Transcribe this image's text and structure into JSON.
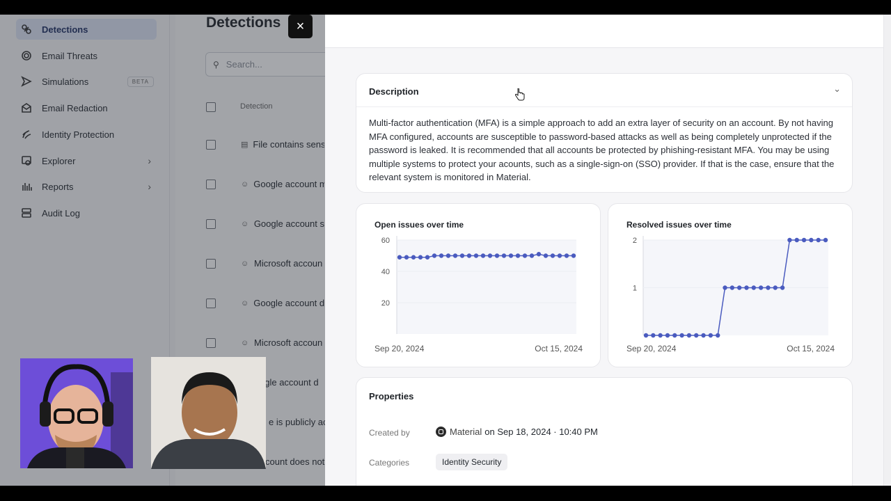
{
  "sidebar": {
    "items": [
      {
        "label": "Detections",
        "icon": "detections-icon",
        "active": true
      },
      {
        "label": "Email Threats",
        "icon": "email-threats-icon"
      },
      {
        "label": "Simulations",
        "icon": "simulations-icon",
        "badge": "BETA"
      },
      {
        "label": "Email Redaction",
        "icon": "email-redaction-icon"
      },
      {
        "label": "Identity Protection",
        "icon": "identity-protection-icon"
      },
      {
        "label": "Explorer",
        "icon": "explorer-icon"
      },
      {
        "label": "Reports",
        "icon": "reports-icon"
      },
      {
        "label": "Audit Log",
        "icon": "audit-log-icon"
      }
    ]
  },
  "main": {
    "title": "Detections",
    "search_placeholder": "Search...",
    "column_header": "Detection",
    "rows": [
      "File contains sens",
      "Google account m",
      "Google account s",
      "Microsoft accoun",
      "Google account d",
      "Microsoft accoun",
      "ogle account d",
      "e is publicly acc",
      "count does not"
    ]
  },
  "drawer": {
    "close_label": "×",
    "description": {
      "title": "Description",
      "text": "Multi-factor authentication (MFA) is a simple approach to add an extra layer of security on an account. By not having MFA configured, accounts are susceptible to password-based attacks as well as being completely unprotected if the password is leaked. It is recommended that all accounts be protected by phishing-resistant MFA. You may be using multiple systems to protect your acounts, such as a single-sign-on (SSO) provider. If that is the case, ensure that the relevant system is monitored in Material."
    },
    "open_chart": {
      "title": "Open issues over time",
      "start": "Sep 20, 2024",
      "end": "Oct 15, 2024"
    },
    "resolved_chart": {
      "title": "Resolved issues over time",
      "start": "Sep 20, 2024",
      "end": "Oct 15, 2024"
    },
    "properties": {
      "title": "Properties",
      "created_by_label": "Created by",
      "created_by_name": "Material",
      "created_on": "on Sep 18, 2024 · 10:40 PM",
      "categories_label": "Categories",
      "category": "Identity Security"
    }
  },
  "chart_data": [
    {
      "type": "line",
      "title": "Open issues over time",
      "x_range": [
        "Sep 20, 2024",
        "Oct 15, 2024"
      ],
      "ylim": [
        0,
        60
      ],
      "yticks": [
        20,
        40,
        60
      ],
      "series": [
        {
          "values": [
            49,
            49,
            49,
            49,
            49,
            50,
            50,
            50,
            50,
            50,
            50,
            50,
            50,
            50,
            50,
            50,
            50,
            50,
            50,
            50,
            51,
            50,
            50,
            50,
            50,
            50
          ]
        }
      ],
      "color": "#4a5bbf"
    },
    {
      "type": "line",
      "title": "Resolved issues over time",
      "x_range": [
        "Sep 20, 2024",
        "Oct 15, 2024"
      ],
      "ylim": [
        0,
        2
      ],
      "yticks": [
        1,
        2
      ],
      "series": [
        {
          "values": [
            0,
            0,
            0,
            0,
            0,
            0,
            0,
            0,
            0,
            0,
            0,
            1,
            1,
            1,
            1,
            1,
            1,
            1,
            1,
            1,
            2,
            2,
            2,
            2,
            2,
            2
          ]
        }
      ],
      "color": "#4a5bbf"
    }
  ]
}
